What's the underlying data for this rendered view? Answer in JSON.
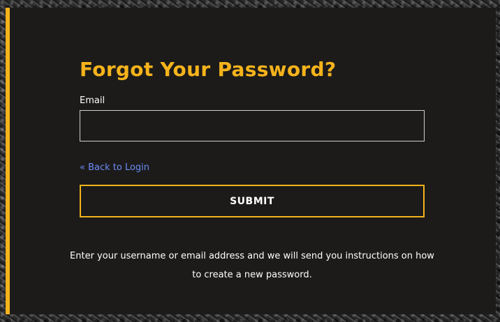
{
  "form": {
    "title": "Forgot Your Password?",
    "email_label": "Email",
    "email_value": "",
    "email_placeholder": "",
    "back_link": "« Back to Login",
    "submit_label": "SUBMIT",
    "help_text": "Enter your username or email address and we will send you instructions on how to create a new password."
  },
  "colors": {
    "accent": "#f6b31b",
    "panel_background": "#1c1b1a",
    "link": "#6c8bf5",
    "text": "#ffffff"
  }
}
